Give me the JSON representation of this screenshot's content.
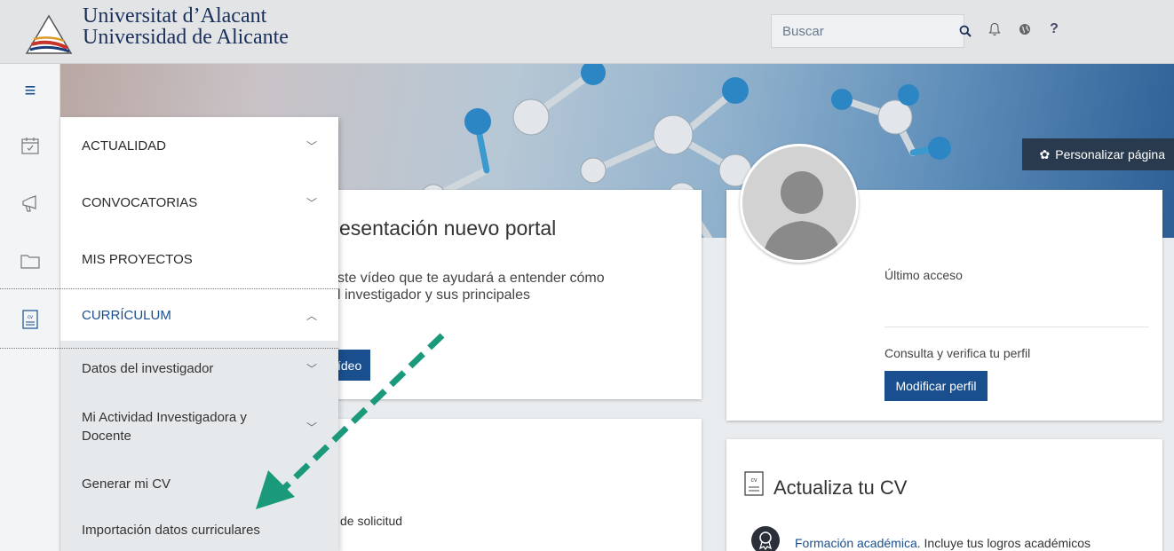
{
  "header": {
    "university_lines": [
      "Universitat d’Alacant",
      "Universidad de Alicante"
    ],
    "search_placeholder": "Buscar",
    "icons": [
      "search-icon",
      "bell-icon",
      "globe-icon",
      "help-icon"
    ],
    "help_label": "?"
  },
  "rail": {
    "toggle_icon": "hamburger-icon",
    "icons": [
      "calendar-icon",
      "megaphone-icon",
      "folder-icon",
      "cv-document-icon"
    ]
  },
  "banner": {
    "personalize_label": "Personalizar página"
  },
  "menu": {
    "items": [
      {
        "label": "ACTUALIDAD"
      },
      {
        "label": "CONVOCATORIAS"
      },
      {
        "label": "MIS PROYECTOS"
      },
      {
        "label": "CURRÍCULUM"
      }
    ],
    "curriculum_sub": [
      {
        "label": "Datos del investigador"
      },
      {
        "label": "Mi Actividad Investigadora y Docente"
      },
      {
        "label": "Generar mi CV"
      },
      {
        "label": "Importación datos curriculares"
      }
    ]
  },
  "presentation_card": {
    "title": "esentación nuevo portal",
    "text": "ste vídeo que te ayudará a entender cómo\nl investigador y sus principales",
    "button_label": "ídeo"
  },
  "solicitud_card": {
    "text": "de solicitud"
  },
  "profile_card": {
    "last_access_label": "Último acceso",
    "consult_label": "Consulta y verifica tu perfil",
    "modify_button": "Modificar perfil"
  },
  "cv_card": {
    "title": "Actualiza tu CV",
    "item_link": "Formación académica",
    "item_text": ". Incluye tus logros académicos"
  },
  "colors": {
    "accent": "#1a4f8f",
    "header_bg": "#e2e4e6",
    "annotation_arrow": "#1a9a7a"
  }
}
